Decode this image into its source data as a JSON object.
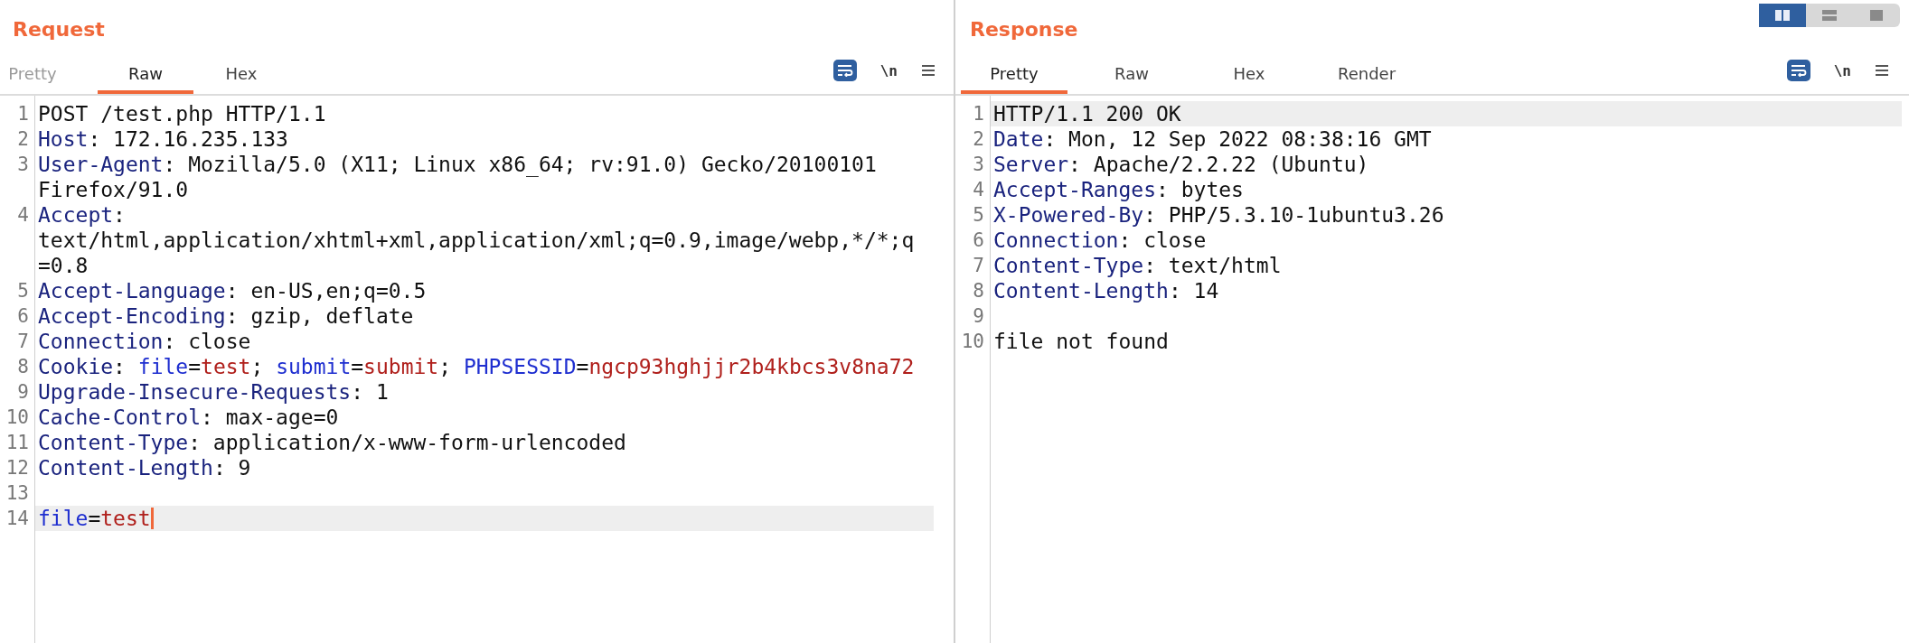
{
  "layout_toggle": [
    {
      "kind": "columns",
      "selected": true
    },
    {
      "kind": "rows",
      "selected": false
    },
    {
      "kind": "single",
      "selected": false
    }
  ],
  "panels": [
    {
      "title": "Request",
      "tabs": [
        {
          "label": "Pretty",
          "selected": false,
          "disabled": true
        },
        {
          "label": "Raw",
          "selected": true,
          "disabled": false
        },
        {
          "label": "Hex",
          "selected": false,
          "disabled": false
        }
      ],
      "wrap_lines": true,
      "newline_label": "\\n",
      "caret": true,
      "lines": [
        {
          "number": "1",
          "current": false,
          "segments": [
            {
              "kind": "plain",
              "text": "POST /test.php HTTP/1.1"
            }
          ]
        },
        {
          "number": "2",
          "current": false,
          "segments": [
            {
              "kind": "name",
              "text": "Host"
            },
            {
              "kind": "plain",
              "text": ": 172.16.235.133"
            }
          ]
        },
        {
          "number": "3",
          "current": false,
          "segments": [
            {
              "kind": "name",
              "text": "User-Agent"
            },
            {
              "kind": "plain",
              "text": ": Mozilla/5.0 (X11; Linux x86_64; rv:91.0) Gecko/20100101 Firefox/91.0"
            }
          ]
        },
        {
          "number": "4",
          "current": false,
          "segments": [
            {
              "kind": "name",
              "text": "Accept"
            },
            {
              "kind": "plain",
              "text": ": text/html,application/xhtml+xml,application/xml;q=0.9,image/webp,*/*;q=0.8"
            }
          ]
        },
        {
          "number": "5",
          "current": false,
          "segments": [
            {
              "kind": "name",
              "text": "Accept-Language"
            },
            {
              "kind": "plain",
              "text": ": en-US,en;q=0.5"
            }
          ]
        },
        {
          "number": "6",
          "current": false,
          "segments": [
            {
              "kind": "name",
              "text": "Accept-Encoding"
            },
            {
              "kind": "plain",
              "text": ": gzip, deflate"
            }
          ]
        },
        {
          "number": "7",
          "current": false,
          "segments": [
            {
              "kind": "name",
              "text": "Connection"
            },
            {
              "kind": "plain",
              "text": ": close"
            }
          ]
        },
        {
          "number": "8",
          "current": false,
          "segments": [
            {
              "kind": "name",
              "text": "Cookie"
            },
            {
              "kind": "plain",
              "text": ": "
            },
            {
              "kind": "param-name",
              "text": "file"
            },
            {
              "kind": "plain",
              "text": "="
            },
            {
              "kind": "param-value",
              "text": "test"
            },
            {
              "kind": "plain",
              "text": "; "
            },
            {
              "kind": "param-name",
              "text": "submit"
            },
            {
              "kind": "plain",
              "text": "="
            },
            {
              "kind": "param-value",
              "text": "submit"
            },
            {
              "kind": "plain",
              "text": "; "
            },
            {
              "kind": "param-name",
              "text": "PHPSESSID"
            },
            {
              "kind": "plain",
              "text": "="
            },
            {
              "kind": "param-value",
              "text": "ngcp93hghjjr2b4kbcs3v8na72"
            }
          ]
        },
        {
          "number": "9",
          "current": false,
          "segments": [
            {
              "kind": "name",
              "text": "Upgrade-Insecure-Requests"
            },
            {
              "kind": "plain",
              "text": ": 1"
            }
          ]
        },
        {
          "number": "10",
          "current": false,
          "segments": [
            {
              "kind": "name",
              "text": "Cache-Control"
            },
            {
              "kind": "plain",
              "text": ": max-age=0"
            }
          ]
        },
        {
          "number": "11",
          "current": false,
          "segments": [
            {
              "kind": "name",
              "text": "Content-Type"
            },
            {
              "kind": "plain",
              "text": ": application/x-www-form-urlencoded"
            }
          ]
        },
        {
          "number": "12",
          "current": false,
          "segments": [
            {
              "kind": "name",
              "text": "Content-Length"
            },
            {
              "kind": "plain",
              "text": ": 9"
            }
          ]
        },
        {
          "number": "13",
          "current": false
        },
        {
          "number": "14",
          "current": true,
          "segments": [
            {
              "kind": "param-name",
              "text": "file"
            },
            {
              "kind": "plain",
              "text": "="
            },
            {
              "kind": "param-value",
              "text": "test"
            }
          ]
        }
      ]
    },
    {
      "title": "Response",
      "tabs": [
        {
          "label": "Pretty",
          "selected": true,
          "disabled": false
        },
        {
          "label": "Raw",
          "selected": false,
          "disabled": false
        },
        {
          "label": "Hex",
          "selected": false,
          "disabled": false
        },
        {
          "label": "Render",
          "selected": false,
          "disabled": false
        }
      ],
      "wrap_lines": true,
      "newline_label": "\\n",
      "lines": [
        {
          "number": "1",
          "current": true,
          "segments": [
            {
              "kind": "plain",
              "text": "HTTP/1.1 200 OK"
            }
          ]
        },
        {
          "number": "2",
          "current": false,
          "segments": [
            {
              "kind": "name",
              "text": "Date"
            },
            {
              "kind": "plain",
              "text": ": Mon, 12 Sep 2022 08:38:16 GMT"
            }
          ]
        },
        {
          "number": "3",
          "current": false,
          "segments": [
            {
              "kind": "name",
              "text": "Server"
            },
            {
              "kind": "plain",
              "text": ": Apache/2.2.22 (Ubuntu)"
            }
          ]
        },
        {
          "number": "4",
          "current": false,
          "segments": [
            {
              "kind": "name",
              "text": "Accept-Ranges"
            },
            {
              "kind": "plain",
              "text": ": bytes"
            }
          ]
        },
        {
          "number": "5",
          "current": false,
          "segments": [
            {
              "kind": "name",
              "text": "X-Powered-By"
            },
            {
              "kind": "plain",
              "text": ": PHP/5.3.10-1ubuntu3.26"
            }
          ]
        },
        {
          "number": "6",
          "current": false,
          "segments": [
            {
              "kind": "name",
              "text": "Connection"
            },
            {
              "kind": "plain",
              "text": ": close"
            }
          ]
        },
        {
          "number": "7",
          "current": false,
          "segments": [
            {
              "kind": "name",
              "text": "Content-Type"
            },
            {
              "kind": "plain",
              "text": ": text/html"
            }
          ]
        },
        {
          "number": "8",
          "current": false,
          "segments": [
            {
              "kind": "name",
              "text": "Content-Length"
            },
            {
              "kind": "plain",
              "text": ": 14"
            }
          ]
        },
        {
          "number": "9",
          "current": false
        },
        {
          "number": "10",
          "current": false,
          "segments": [
            {
              "kind": "plain",
              "text": "file not found"
            }
          ]
        }
      ]
    }
  ]
}
